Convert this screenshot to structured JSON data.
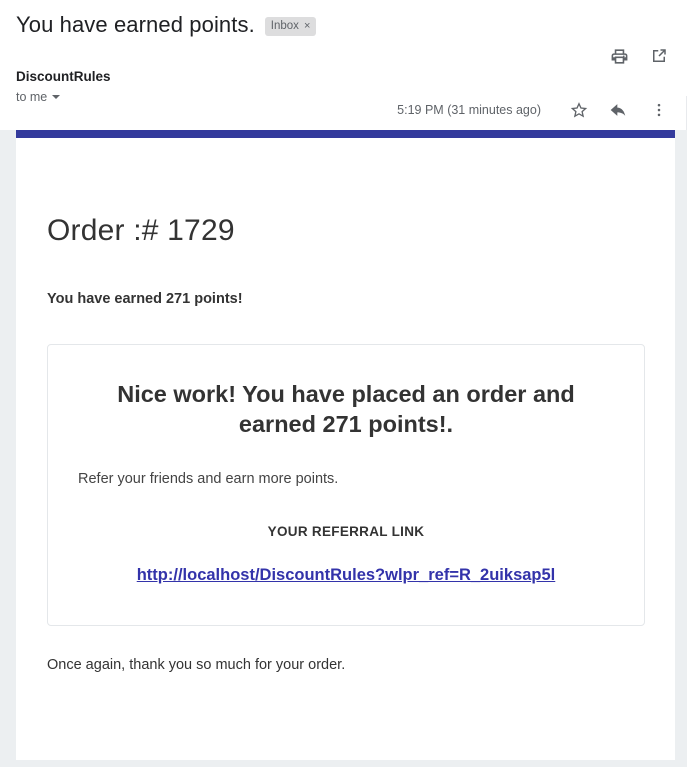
{
  "header": {
    "subject": "You have earned points.",
    "label": "Inbox",
    "label_close": "×",
    "sender": "DiscountRules",
    "recipient": "to me",
    "timestamp": "5:19 PM (31 minutes ago)",
    "icons": {
      "print": "print-icon",
      "open_in_new": "open-in-new-icon",
      "star": "star-icon",
      "reply": "reply-icon",
      "more": "more-vertical-icon"
    }
  },
  "email": {
    "brand_bar_color": "#333a9c",
    "order_title": "Order :# 1729",
    "points_line": "You have earned 271 points!",
    "card": {
      "heading": "Nice work! You have placed an order and earned 271 points!.",
      "subtext": "Refer your friends and earn more points.",
      "referral_label": "YOUR REFERRAL LINK",
      "referral_link": "http://localhost/DiscountRules?wlpr_ref=R_2uiksap5l",
      "link_color": "#3333aa"
    },
    "closing": "Once again, thank you so much for your order."
  }
}
